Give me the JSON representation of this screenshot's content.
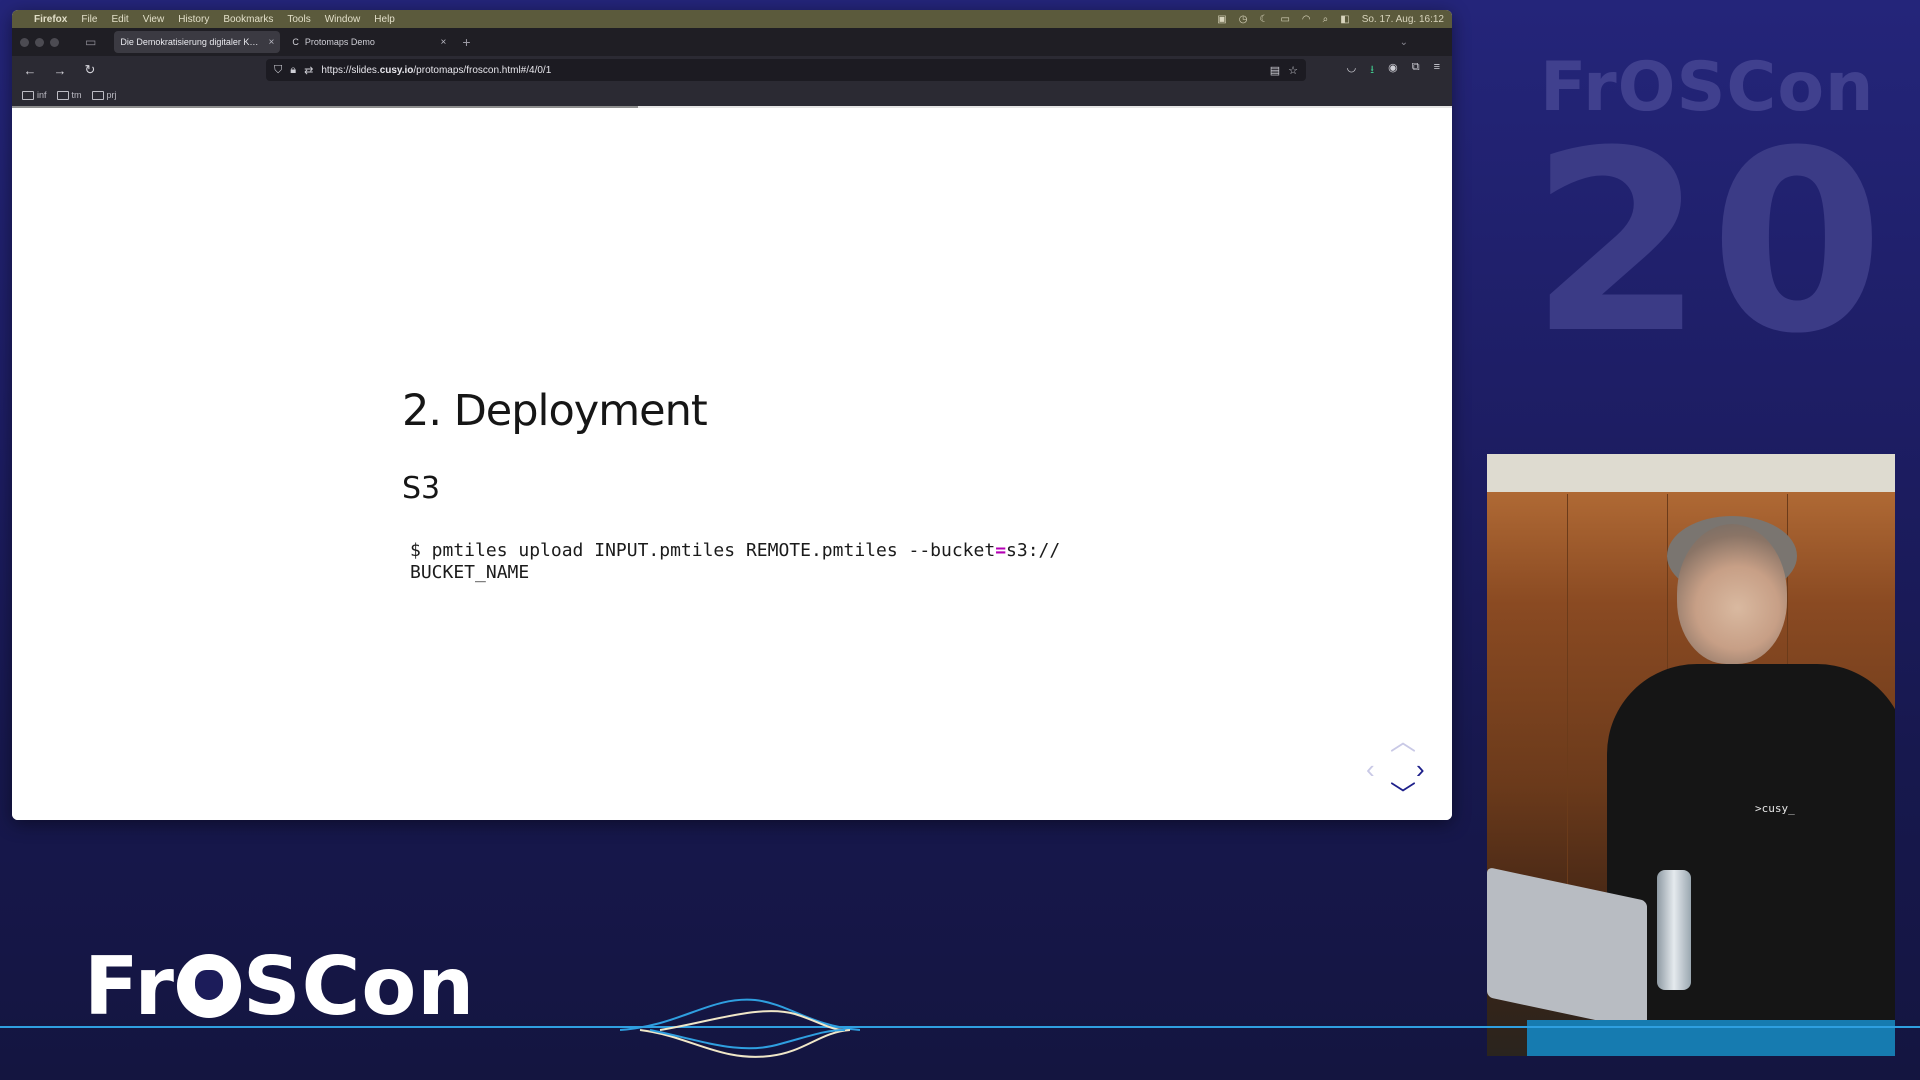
{
  "menubar": {
    "apple": "",
    "app": "Firefox",
    "items": [
      "File",
      "Edit",
      "View",
      "History",
      "Bookmarks",
      "Tools",
      "Window",
      "Help"
    ],
    "clock": "So. 17. Aug.  16:12"
  },
  "tabs": [
    {
      "title": "Die Demokratisierung digitaler Karte",
      "close": "×"
    },
    {
      "title": "Protomaps Demo",
      "close": "×"
    }
  ],
  "new_tab": "+",
  "navbar": {
    "back": "←",
    "forward": "→",
    "reload": "↻",
    "url_prefix": "https://slides.",
    "url_domain": "cusy.io",
    "url_path": "/protomaps/froscon.html#/4/0/1"
  },
  "bookmarks": [
    "inf",
    "tm",
    "prj"
  ],
  "slide": {
    "title": "2. Deployment",
    "subtitle": "S3",
    "code_line1_a": "$ pmtiles upload INPUT.pmtiles REMOTE.pmtiles --bucket",
    "code_eq": "=",
    "code_line1_b": "s3://",
    "code_line2": "BUCKET_NAME"
  },
  "overlay": {
    "logo": "FrOSCon",
    "logo_big_a": "Fr",
    "logo_big_b": "SCon",
    "anniversary": "20",
    "badge": ">cusy_"
  },
  "colors": {
    "background": "#1d1d63",
    "accent_line": "#2f9fe0",
    "slide_nav": "#1d1f8a",
    "code_operator": "#b400b4"
  }
}
